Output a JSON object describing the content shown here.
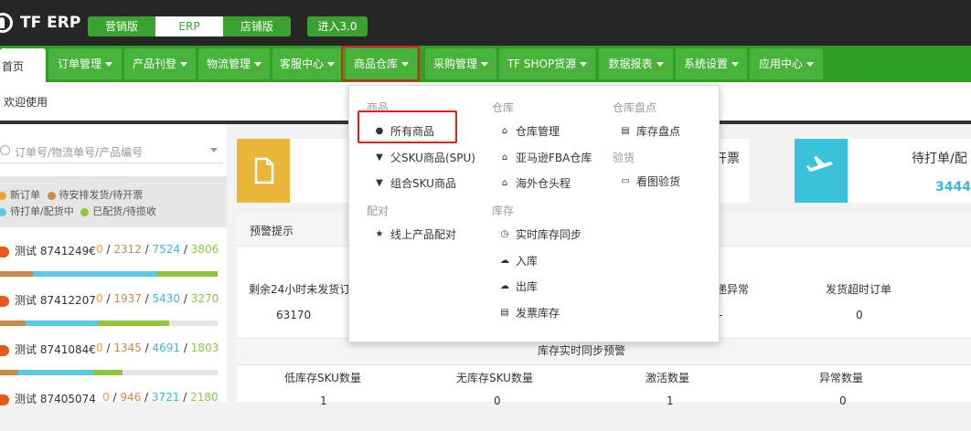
{
  "header": {
    "logo_text": "TF ERP",
    "versions": [
      "营销版",
      "ERP",
      "店铺版"
    ],
    "enter_label": "进入3.0"
  },
  "nav": {
    "home": "首页",
    "tabs": [
      "订单管理",
      "产品刊登",
      "物流管理",
      "客服中心",
      "商品仓库",
      "采购管理",
      "TF SHOP货源",
      "数据报表",
      "系统设置",
      "应用中心"
    ]
  },
  "welcome": "欢迎使用",
  "sidebar": {
    "search_placeholder": "订单号/物流单号/产品编号",
    "legend": [
      {
        "label": "新订单",
        "color": "#f0a030"
      },
      {
        "label": "待安排发货/待开票",
        "color": "#c98a4a"
      },
      {
        "label": "待打单/配货中",
        "color": "#5bc8e8"
      },
      {
        "label": "已配货/待揽收",
        "color": "#8cc63e"
      }
    ],
    "orders": [
      {
        "name": "测试 8741249€",
        "n0": "0",
        "n1": "2312",
        "n2": "7524",
        "n3": "3806"
      },
      {
        "name": "测试 87412207",
        "n0": "0",
        "n1": "1937",
        "n2": "5430",
        "n3": "3270"
      },
      {
        "name": "测试 8741084€",
        "n0": "0",
        "n1": "1345",
        "n2": "4691",
        "n3": "1803"
      },
      {
        "name": "测试 87405074",
        "n0": "0",
        "n1": "946",
        "n2": "3721",
        "n3": "2180"
      }
    ]
  },
  "cards": {
    "card1_text": "开票",
    "card2_text": "待打单/配",
    "card2_value": "3444"
  },
  "panel": {
    "title": "预警提示",
    "stats_row1": [
      {
        "label": "剩余24小时未发货订",
        "value": "63170"
      },
      {
        "label": "运递异常",
        "value": "-"
      },
      {
        "label": "发货超时订单",
        "value": "0"
      }
    ],
    "sync_title": "库存实时同步预警",
    "stats_row2": [
      {
        "label": "低库存SKU数量",
        "value": "1"
      },
      {
        "label": "无库存SKU数量",
        "value": "0"
      },
      {
        "label": "激活数量",
        "value": "1"
      },
      {
        "label": "异常数量",
        "value": "0"
      }
    ]
  },
  "dropdown": {
    "col1": {
      "head1": "商品",
      "items1": [
        "所有商品",
        "父SKU商品(SPU)",
        "组合SKU商品"
      ],
      "head2": "配对",
      "items2": [
        "线上产品配对"
      ]
    },
    "col2": {
      "head1": "仓库",
      "items1": [
        "仓库管理",
        "亚马逊FBA仓库",
        "海外仓头程"
      ],
      "head2": "库存",
      "items2": [
        "实时库存同步",
        "入库",
        "出库",
        "发票库存"
      ]
    },
    "col3": {
      "head1": "仓库盘点",
      "items1": [
        "库存盘点"
      ],
      "head2": "验货",
      "items2": [
        "看图验货"
      ]
    }
  },
  "colors": {
    "nav_green": "#2f9f27",
    "tab_green": "#48b33a",
    "highlight_red": "#e01f1f",
    "n1": "#c98a4a",
    "n2": "#39b8e0",
    "n3": "#8cc63e"
  }
}
